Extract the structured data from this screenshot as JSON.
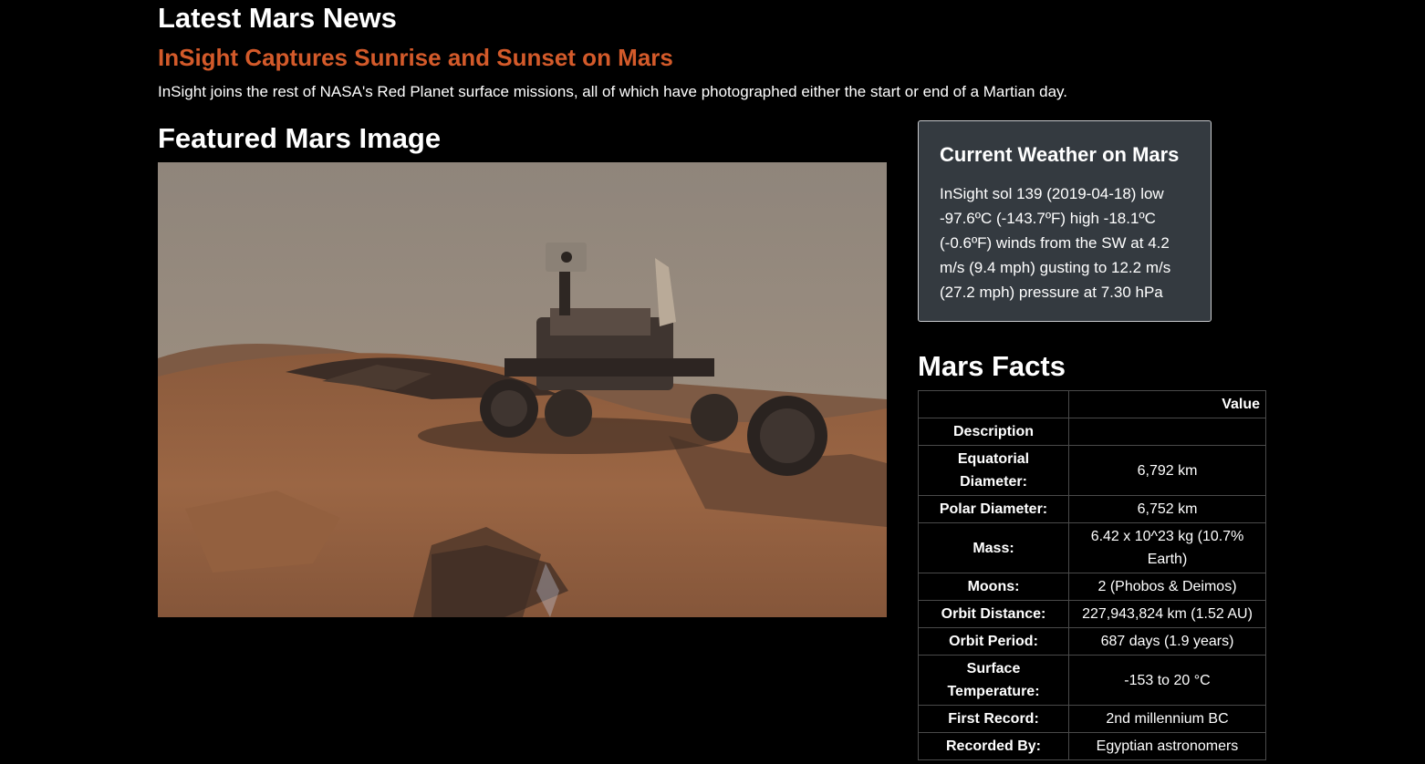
{
  "news": {
    "heading": "Latest Mars News",
    "title": "InSight Captures Sunrise and Sunset on Mars",
    "teaser": "InSight joins the rest of NASA's Red Planet surface missions, all of which have photographed either the start or end of a Martian day."
  },
  "featured": {
    "heading": "Featured Mars Image"
  },
  "weather": {
    "title": "Current Weather on Mars",
    "text": "InSight sol 139 (2019-04-18) low -97.6ºC (-143.7ºF) high -18.1ºC (-0.6ºF) winds from the SW at 4.2 m/s (9.4 mph) gusting to 12.2 m/s (27.2 mph) pressure at 7.30 hPa"
  },
  "facts": {
    "heading": "Mars Facts",
    "header_value": "Value",
    "header_desc": "Description",
    "rows": [
      {
        "label": "Equatorial Diameter:",
        "value": "6,792 km"
      },
      {
        "label": "Polar Diameter:",
        "value": "6,752 km"
      },
      {
        "label": "Mass:",
        "value": "6.42 x 10^23 kg (10.7% Earth)"
      },
      {
        "label": "Moons:",
        "value": "2 (Phobos & Deimos)"
      },
      {
        "label": "Orbit Distance:",
        "value": "227,943,824 km (1.52 AU)"
      },
      {
        "label": "Orbit Period:",
        "value": "687 days (1.9 years)"
      },
      {
        "label": "Surface Temperature:",
        "value": "-153 to 20 °C"
      },
      {
        "label": "First Record:",
        "value": "2nd millennium BC"
      },
      {
        "label": "Recorded By:",
        "value": "Egyptian astronomers"
      }
    ]
  },
  "colors": {
    "background": "#000000",
    "news_title": "#d35a2a",
    "card_background": "#343a40",
    "card_border": "#c7c9cc"
  }
}
